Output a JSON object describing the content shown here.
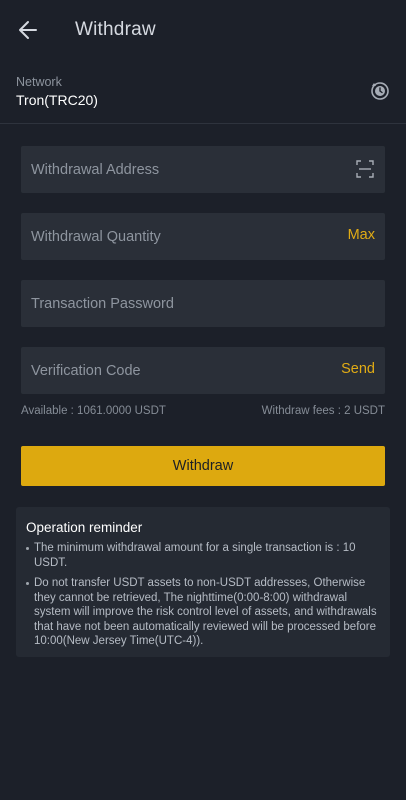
{
  "header": {
    "title": "Withdraw"
  },
  "network": {
    "label": "Network",
    "value": "Tron(TRC20)"
  },
  "form": {
    "address_placeholder": "Withdrawal Address",
    "quantity_placeholder": "Withdrawal Quantity",
    "quantity_action": "Max",
    "password_placeholder": "Transaction Password",
    "code_placeholder": "Verification Code",
    "code_action": "Send"
  },
  "info": {
    "available": "Available : 1061.0000 USDT",
    "fees": "Withdraw fees : 2 USDT"
  },
  "button": {
    "label": "Withdraw"
  },
  "reminder": {
    "title": "Operation reminder",
    "items": [
      "The minimum withdrawal amount for a single transaction is : 10 USDT.",
      "Do not transfer USDT assets to non-USDT addresses, Otherwise they cannot be retrieved, The nighttime(0:00-8:00) withdrawal system will improve the risk control level of assets, and withdrawals that have not been automatically reviewed will be processed before 10:00(New Jersey Time(UTC-4))."
    ]
  },
  "icons": {
    "back": "arrow-left-icon",
    "network_switch": "switch-network-icon",
    "scan": "scan-qr-icon"
  },
  "colors": {
    "background": "#1c2029",
    "field": "#2a2f38",
    "accent": "#dda90f",
    "action_text": "#e0ab15"
  }
}
